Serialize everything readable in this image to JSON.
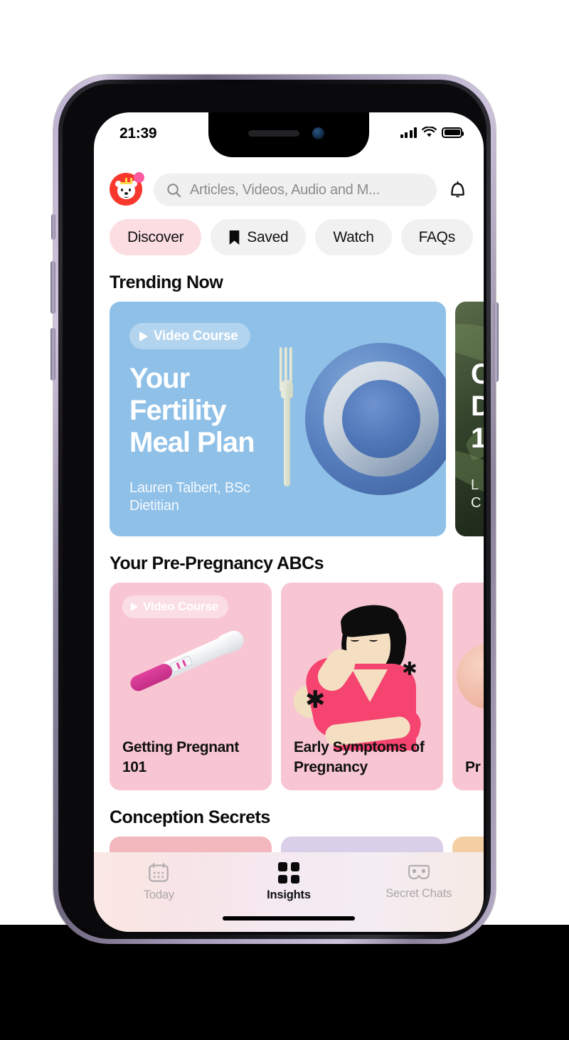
{
  "status_bar": {
    "time": "21:39",
    "signal_icon": "cellular-bars-icon",
    "wifi_icon": "wifi-icon",
    "battery_icon": "battery-icon"
  },
  "header": {
    "avatar_name": "bear-avatar",
    "notification_dot": "notification-dot",
    "search_placeholder": "Articles, Videos, Audio and M...",
    "search_icon": "search-icon",
    "bell_icon": "bell-icon"
  },
  "filter_pills": [
    {
      "label": "Discover",
      "active": true,
      "icon": ""
    },
    {
      "label": "Saved",
      "active": false,
      "icon": "bookmark-icon"
    },
    {
      "label": "Watch",
      "active": false,
      "icon": ""
    },
    {
      "label": "FAQs",
      "active": false,
      "icon": ""
    }
  ],
  "sections": [
    {
      "title": "Trending Now"
    },
    {
      "title": "Your Pre-Pregnancy ABCs"
    },
    {
      "title": "Conception Secrets"
    }
  ],
  "trending_cards": [
    {
      "badge": "Video Course",
      "title_lines": [
        "Your",
        "Fertility",
        "Meal Plan"
      ],
      "author": "Lauren Talbert, BSc",
      "author_role": "Dietitian",
      "bg_color": "#8fc0e8"
    },
    {
      "badge": "",
      "title_lines": [
        "C",
        "D",
        "1"
      ],
      "author": "L",
      "author_role": "C",
      "bg_color": "#33432b"
    }
  ],
  "abc_cards": [
    {
      "badge": "Video Course",
      "title": "Getting Pregnant 101",
      "bg_color": "#f8c6d2"
    },
    {
      "badge": "",
      "title": "Early Symptoms of Pregnancy",
      "bg_color": "#f8c6d2"
    },
    {
      "badge": "",
      "title": "Pr Su",
      "bg_color": "#f8c6d2"
    }
  ],
  "conception_cards": [
    {
      "bg_color": "#f3b8bd"
    },
    {
      "bg_color": "#d9cfe8"
    },
    {
      "bg_color": "#f5cfa4"
    }
  ],
  "tab_bar": [
    {
      "label": "Today",
      "icon": "calendar-icon",
      "active": false
    },
    {
      "label": "Insights",
      "icon": "grid-icon",
      "active": true
    },
    {
      "label": "Secret Chats",
      "icon": "mask-icon",
      "active": false
    }
  ]
}
